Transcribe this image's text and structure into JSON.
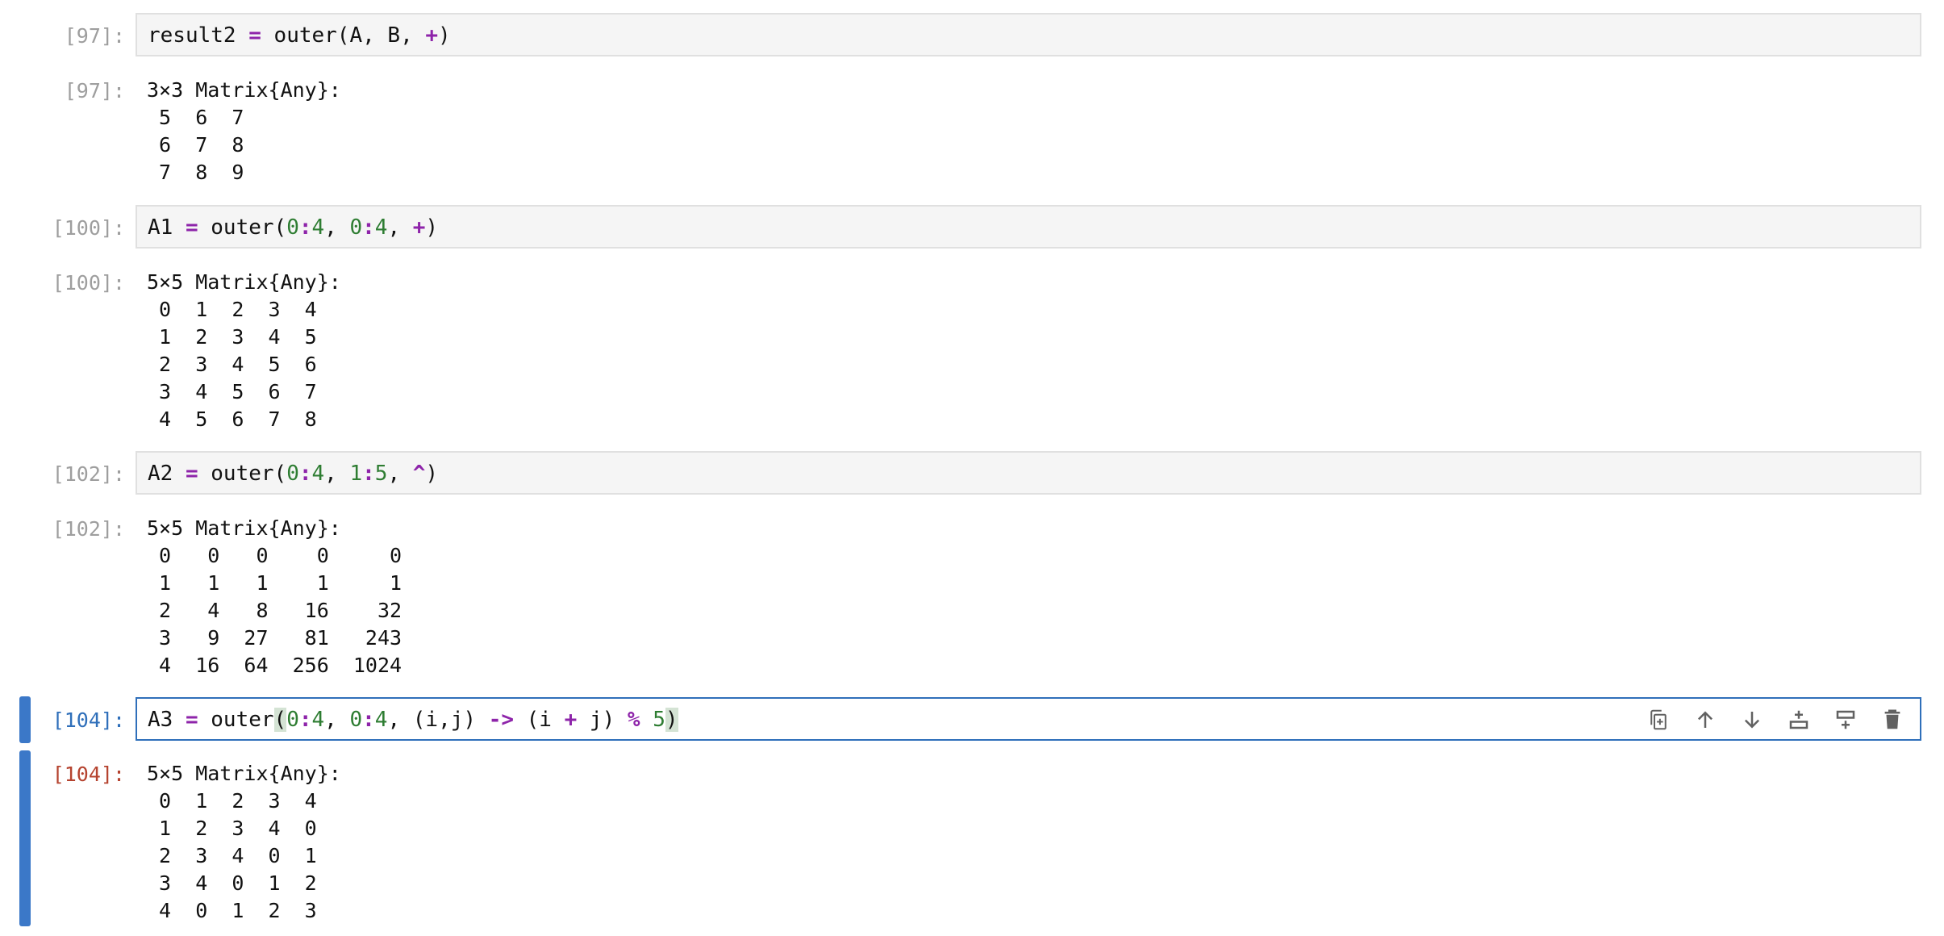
{
  "cells": [
    {
      "in_prompt": "[97]:",
      "code": [
        {
          "t": "result2 "
        },
        {
          "t": "=",
          "c": "op"
        },
        {
          "t": " outer(A, B, "
        },
        {
          "t": "+",
          "c": "op"
        },
        {
          "t": ")"
        }
      ],
      "out_prompt": "[97]:",
      "output": [
        "3×3 Matrix{Any}:",
        " 5  6  7",
        " 6  7  8",
        " 7  8  9"
      ]
    },
    {
      "in_prompt": "[100]:",
      "code": [
        {
          "t": "A1 "
        },
        {
          "t": "=",
          "c": "op"
        },
        {
          "t": " outer("
        },
        {
          "t": "0",
          "c": "num"
        },
        {
          "t": ":",
          "c": "op"
        },
        {
          "t": "4",
          "c": "num"
        },
        {
          "t": ", "
        },
        {
          "t": "0",
          "c": "num"
        },
        {
          "t": ":",
          "c": "op"
        },
        {
          "t": "4",
          "c": "num"
        },
        {
          "t": ", "
        },
        {
          "t": "+",
          "c": "op"
        },
        {
          "t": ")"
        }
      ],
      "out_prompt": "[100]:",
      "output": [
        "5×5 Matrix{Any}:",
        " 0  1  2  3  4",
        " 1  2  3  4  5",
        " 2  3  4  5  6",
        " 3  4  5  6  7",
        " 4  5  6  7  8"
      ]
    },
    {
      "in_prompt": "[102]:",
      "code": [
        {
          "t": "A2 "
        },
        {
          "t": "=",
          "c": "op"
        },
        {
          "t": " outer("
        },
        {
          "t": "0",
          "c": "num"
        },
        {
          "t": ":",
          "c": "op"
        },
        {
          "t": "4",
          "c": "num"
        },
        {
          "t": ", "
        },
        {
          "t": "1",
          "c": "num"
        },
        {
          "t": ":",
          "c": "op"
        },
        {
          "t": "5",
          "c": "num"
        },
        {
          "t": ", "
        },
        {
          "t": "^",
          "c": "op"
        },
        {
          "t": ")"
        }
      ],
      "out_prompt": "[102]:",
      "output": [
        "5×5 Matrix{Any}:",
        " 0   0   0    0     0",
        " 1   1   1    1     1",
        " 2   4   8   16    32",
        " 3   9  27   81   243",
        " 4  16  64  256  1024"
      ]
    },
    {
      "in_prompt": "[104]:",
      "active": true,
      "code": [
        {
          "t": "A3 "
        },
        {
          "t": "=",
          "c": "op"
        },
        {
          "t": " outer"
        },
        {
          "t": "(",
          "c": "hl"
        },
        {
          "t": "0",
          "c": "num"
        },
        {
          "t": ":",
          "c": "op"
        },
        {
          "t": "4",
          "c": "num"
        },
        {
          "t": ", "
        },
        {
          "t": "0",
          "c": "num"
        },
        {
          "t": ":",
          "c": "op"
        },
        {
          "t": "4",
          "c": "num"
        },
        {
          "t": ", (i,j) "
        },
        {
          "t": "->",
          "c": "op"
        },
        {
          "t": " (i "
        },
        {
          "t": "+",
          "c": "op"
        },
        {
          "t": " j) "
        },
        {
          "t": "%",
          "c": "op"
        },
        {
          "t": " "
        },
        {
          "t": "5",
          "c": "num"
        },
        {
          "t": ")",
          "c": "hl"
        }
      ],
      "out_prompt": "[104]:",
      "output": [
        "5×5 Matrix{Any}:",
        " 0  1  2  3  4",
        " 1  2  3  4  0",
        " 2  3  4  0  1",
        " 3  4  0  1  2",
        " 4  0  1  2  3"
      ]
    }
  ],
  "toolbar": [
    {
      "name": "duplicate-cell-icon",
      "label": "Duplicate"
    },
    {
      "name": "move-up-icon",
      "label": "Move up"
    },
    {
      "name": "move-down-icon",
      "label": "Move down"
    },
    {
      "name": "insert-above-icon",
      "label": "Insert above"
    },
    {
      "name": "insert-below-icon",
      "label": "Insert below"
    },
    {
      "name": "delete-cell-icon",
      "label": "Delete"
    }
  ],
  "colors": {
    "accent": "#2f6fba",
    "operator": "#8e24aa",
    "number": "#2e7d32",
    "prompt": "#9e9e9e",
    "active_out_prompt": "#b5432f"
  }
}
